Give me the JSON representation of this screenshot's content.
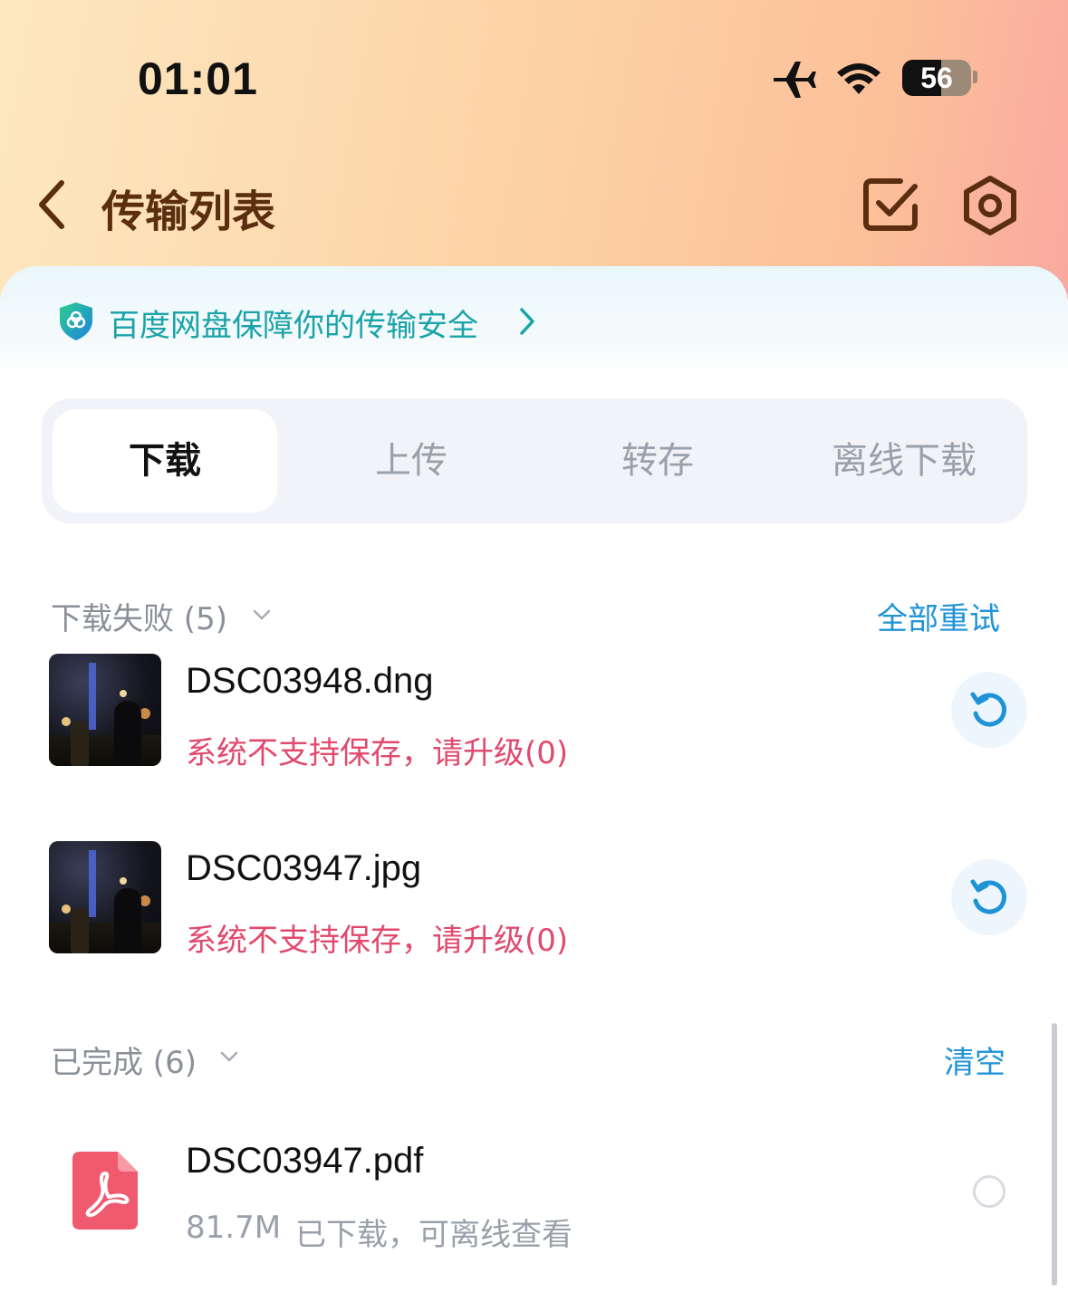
{
  "status_bar": {
    "time": "01:01",
    "battery": "56",
    "battery_level_percent": 56
  },
  "nav": {
    "title": "传输列表",
    "back_icon": "chevron-left-icon",
    "select_icon": "checkbox-icon",
    "settings_icon": "hexagon-gear-icon"
  },
  "security_banner": {
    "text": "百度网盘保障你的传输安全",
    "icon": "shield-icon"
  },
  "tabs": [
    {
      "label": "下载",
      "active": true
    },
    {
      "label": "上传",
      "active": false
    },
    {
      "label": "转存",
      "active": false
    },
    {
      "label": "离线下载",
      "active": false
    }
  ],
  "failed_section": {
    "title": "下载失败 (5)",
    "action": "全部重试",
    "items": [
      {
        "name": "DSC03948.dng",
        "status": "系统不支持保存，请升级(0)"
      },
      {
        "name": "DSC03947.jpg",
        "status": "系统不支持保存，请升级(0)"
      }
    ]
  },
  "done_section": {
    "title": "已完成 (6)",
    "action": "清空",
    "items": [
      {
        "name": "DSC03947.pdf",
        "size": "81.7M",
        "status": "已下载，可离线查看"
      }
    ]
  },
  "colors": {
    "accent": "#1f93d6",
    "error": "#e04a6e",
    "title_brown": "#5a2e0f",
    "security_teal": "#1aa3a8"
  }
}
